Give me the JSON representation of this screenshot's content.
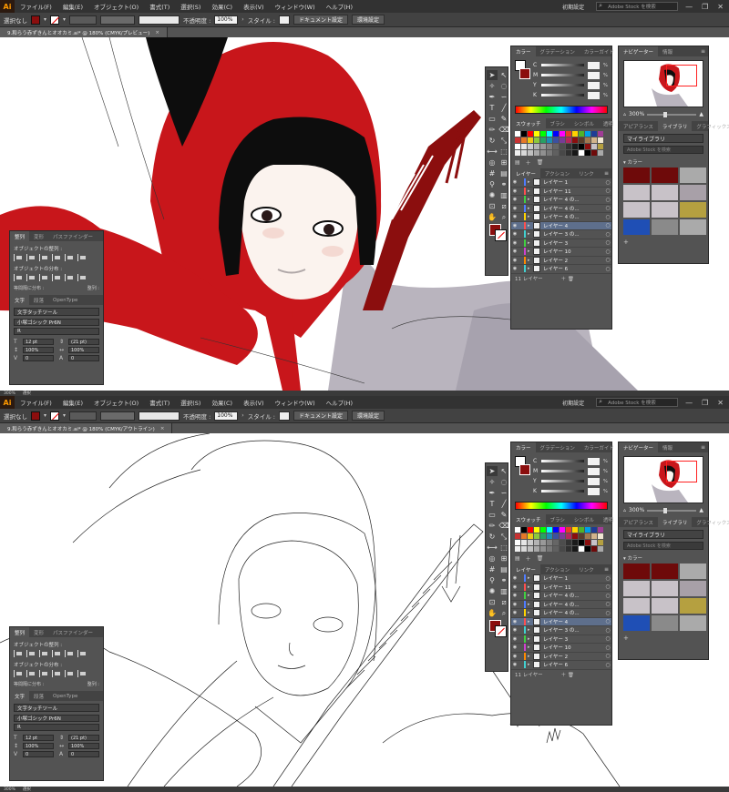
{
  "app": {
    "logo": "Ai",
    "menus": [
      "ファイル(F)",
      "編集(E)",
      "オブジェクト(O)",
      "書式(T)",
      "選択(S)",
      "効果(C)",
      "表示(V)",
      "ウィンドウ(W)",
      "ヘルプ(H)"
    ],
    "workspace": "初期設定",
    "stock_search_placeholder": "Adobe Stock を検索",
    "window_controls": [
      "—",
      "❐",
      "✕"
    ]
  },
  "control_bar": {
    "selection_label": "選択なし",
    "opacity_label": "不透明度 :",
    "opacity_value": "100%",
    "style_label": "スタイル :",
    "doc_settings_button": "ドキュメント設定",
    "prefs_button": "環境設定"
  },
  "top_view": {
    "doc_tab": "9.和らう赤ずきんとオオカミ.ai* @ 180% (CMYK/プレビュー)",
    "status_zoom": "300%",
    "status_tool": "選択"
  },
  "bottom_view": {
    "doc_tab": "9.和らう赤ずきんとオオカミ.ai* @ 180% (CMYK/アウトライン)",
    "status_zoom": "300%",
    "status_tool": "選択"
  },
  "color_panel": {
    "tabs": [
      "カラー",
      "グラデーション",
      "カラーガイド"
    ],
    "channels": [
      {
        "label": "C",
        "unit": "%"
      },
      {
        "label": "M",
        "unit": "%"
      },
      {
        "label": "Y",
        "unit": "%"
      },
      {
        "label": "K",
        "unit": "%"
      }
    ],
    "swatch_tabs": [
      "スウォッチ",
      "ブラシ",
      "シンボル",
      "透明"
    ]
  },
  "layers_panel": {
    "tabs": [
      "レイヤー",
      "アクション",
      "リンク"
    ],
    "layers": [
      {
        "name": "レイヤー 1",
        "color": "#4f7cff",
        "selected": false
      },
      {
        "name": "レイヤー 11",
        "color": "#ff4f4f",
        "selected": false
      },
      {
        "name": "レイヤー 4 の...",
        "color": "#41d041",
        "selected": false
      },
      {
        "name": "レイヤー 4 の...",
        "color": "#4f7cff",
        "selected": false
      },
      {
        "name": "レイヤー 4 の...",
        "color": "#ffd400",
        "selected": false
      },
      {
        "name": "レイヤー 4",
        "color": "#ff4f4f",
        "selected": true
      },
      {
        "name": "レイヤー 3 の...",
        "color": "#41d0d0",
        "selected": false
      },
      {
        "name": "レイヤー 3",
        "color": "#41d041",
        "selected": false
      },
      {
        "name": "レイヤー 10",
        "color": "#d041d0",
        "selected": false
      },
      {
        "name": "レイヤー 2",
        "color": "#ff8a00",
        "selected": false
      },
      {
        "name": "レイヤー 6",
        "color": "#41d0d0",
        "selected": false
      }
    ],
    "footer_count": "11 レイヤー"
  },
  "navigator_panel": {
    "tabs": [
      "ナビゲーター",
      "情報"
    ],
    "zoom": "300%",
    "library_tabs": [
      "アピアランス",
      "ライブラリ",
      "グラフィックスタイル"
    ],
    "library_name": "マイライブラリ",
    "library_search": "Adobe Stock を検索",
    "color_section": "カラー",
    "library_colors": [
      "#6e0a0a",
      "#6e0a0a",
      "#aaaaaa",
      "#c8c2c8",
      "#c8c2c8",
      "#a8a0a8",
      "#c8c2c8",
      "#c8c2c8",
      "#b5a040",
      "#1f4fb5",
      "#8a8a8a",
      "#aaaaaa"
    ]
  },
  "align_panel": {
    "tabs": [
      "整列",
      "変形",
      "パスファインダー"
    ],
    "align_objects_label": "オブジェクトの整列 :",
    "distribute_objects_label": "オブジェクトの分布 :",
    "distribute_spacing_label": "等間隔に分布 :",
    "align_to_label": "整列 :",
    "type_tabs": [
      "文字",
      "段落",
      "OpenType"
    ],
    "touch_type_button": "文字タッチツール",
    "font_family": "小塚ゴシック Pr6N",
    "font_style": "R",
    "font_size": "12 pt",
    "leading": "(21 pt)",
    "vscale": "100%",
    "hscale": "100%",
    "tracking_a": "0",
    "tracking_b": "0"
  },
  "swatches": [
    "#ffffff",
    "#000000",
    "#ff0000",
    "#ffff00",
    "#00ff00",
    "#00ffff",
    "#0000ff",
    "#ff00ff",
    "#e63c28",
    "#ffd200",
    "#50b428",
    "#00a0e6",
    "#1e3c96",
    "#a03c96",
    "#c83232",
    "#e67828",
    "#f0c814",
    "#8cc83c",
    "#28a064",
    "#1e8cb4",
    "#3c50a0",
    "#783c96",
    "#b4285a",
    "#8b0e0e",
    "#5a3c28",
    "#a07850",
    "#d2b48c",
    "#f0e6d2",
    "#ffffff",
    "#e6e6e6",
    "#cccccc",
    "#b3b3b3",
    "#999999",
    "#808080",
    "#666666",
    "#4d4d4d",
    "#333333",
    "#1a1a1a",
    "#000000",
    "#8b0e0e",
    "#c8c2c8",
    "#b5a040",
    "#f0f0f0",
    "#d8d8d8",
    "#c0c0c0",
    "#a8a8a8",
    "#909090",
    "#787878",
    "#606060",
    "#484848",
    "#303030",
    "#181818",
    "#ffffff",
    "#000000",
    "#6e0a0a",
    "#aaaaaa"
  ],
  "colors": {
    "hood_red": "#c8161b",
    "dark_red": "#8b0e0e",
    "hair": "#0d0d0d",
    "wolf_fur": "#b9b4be",
    "ui_bg": "#535353",
    "selected_layer": "#5e6f8c"
  }
}
